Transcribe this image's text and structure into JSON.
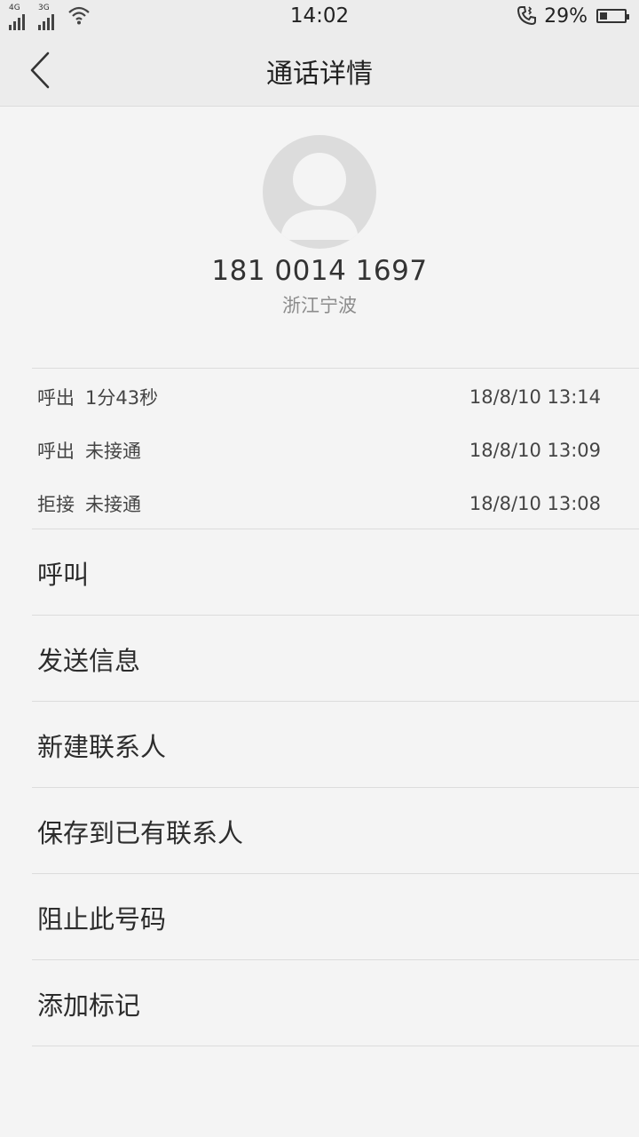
{
  "status_bar": {
    "sim1_label": "4G",
    "sim2_label": "3G",
    "time": "14:02",
    "battery_percent": "29%",
    "battery_level": 0.29
  },
  "header": {
    "title": "通话详情"
  },
  "contact": {
    "number": "181 0014 1697",
    "location": "浙江宁波"
  },
  "call_log": [
    {
      "type": "呼出",
      "detail": "1分43秒",
      "time": "18/8/10 13:14"
    },
    {
      "type": "呼出",
      "detail": "未接通",
      "time": "18/8/10 13:09"
    },
    {
      "type": "拒接",
      "detail": "未接通",
      "time": "18/8/10 13:08"
    }
  ],
  "actions": [
    {
      "label": "呼叫"
    },
    {
      "label": "发送信息"
    },
    {
      "label": "新建联系人"
    },
    {
      "label": "保存到已有联系人"
    },
    {
      "label": "阻止此号码"
    },
    {
      "label": "添加标记"
    }
  ],
  "colors": {
    "background": "#f4f4f4",
    "header": "#ececec",
    "divider": "#dcdcdc",
    "avatar": "#dcdcdc"
  }
}
